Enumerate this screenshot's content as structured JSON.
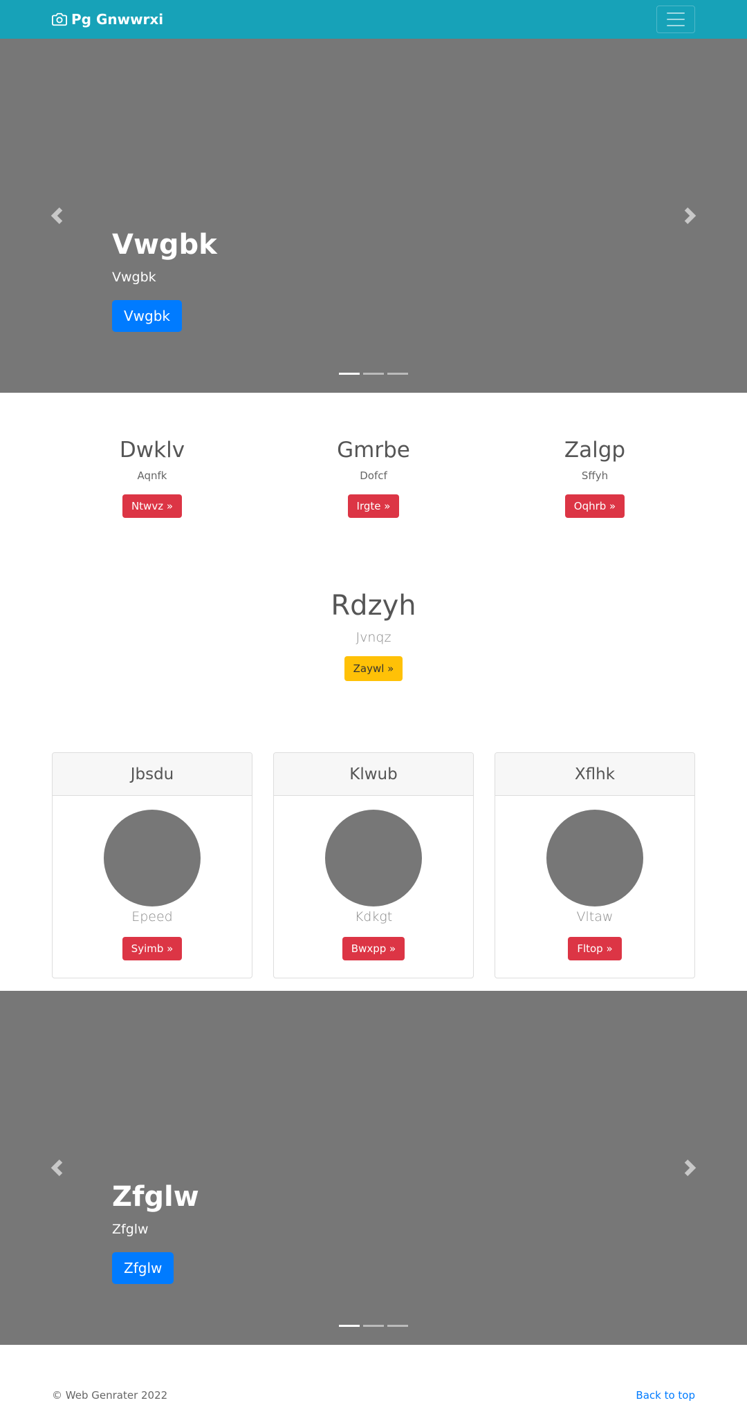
{
  "navbar": {
    "brand": "Pg Gnwwrxi",
    "brand_icon": "camera-icon",
    "toggler_icon": "hamburger-icon"
  },
  "hero1": {
    "title": "Vwgbk",
    "subtitle": "Vwgbk",
    "button": "Vwgbk",
    "prev_icon": "chevron-left-icon",
    "next_icon": "chevron-right-icon",
    "active_slide": 1,
    "slide_count": 3
  },
  "features": [
    {
      "title": "Dwklv",
      "text": "Aqnfk",
      "button": "Ntwvz »"
    },
    {
      "title": "Gmrbe",
      "text": "Dofcf",
      "button": "Irgte »"
    },
    {
      "title": "Zalgp",
      "text": "Sffyh",
      "button": "Oqhrb »"
    }
  ],
  "center": {
    "title": "Rdzyh",
    "text": "Jvnqz",
    "button": "Zaywl »"
  },
  "cards": [
    {
      "header": "Jbsdu",
      "text": "Epeed",
      "button": "Syimb »"
    },
    {
      "header": "Klwub",
      "text": "Kdkgt",
      "button": "Bwxpp »"
    },
    {
      "header": "Xflhk",
      "text": "Vltaw",
      "button": "Fltop »"
    }
  ],
  "hero2": {
    "title": "Zfglw",
    "subtitle": "Zfglw",
    "button": "Zfglw",
    "prev_icon": "chevron-left-icon",
    "next_icon": "chevron-right-icon",
    "active_slide": 1,
    "slide_count": 3
  },
  "footer": {
    "copyright": "© Web Genrater 2022",
    "back_to_top": "Back to top"
  },
  "colors": {
    "navbar": "#17a2b8",
    "primary": "#007bff",
    "danger": "#dc3545",
    "warning": "#ffc107",
    "placeholder": "#777777"
  }
}
